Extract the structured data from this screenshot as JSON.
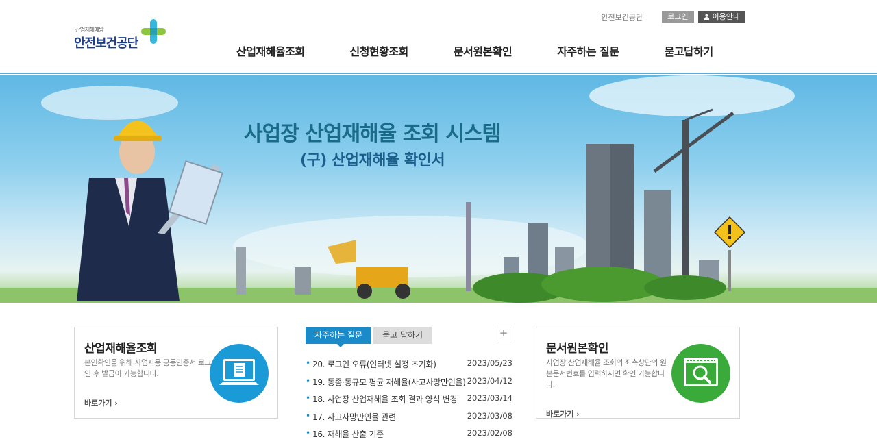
{
  "header": {
    "logo_small": "산업재해예방",
    "logo_main": "안전보건공단",
    "top_link": "안전보건공단",
    "login_label": "로그인",
    "guide_label": "이용안내",
    "nav": [
      "산업재해율조회",
      "신청현황조회",
      "문서원본확인",
      "자주하는 질문",
      "묻고답하기"
    ]
  },
  "hero": {
    "title": "사업장 산업재해율 조회 시스템",
    "subtitle": "(구) 산업재해율 확인서"
  },
  "box_left": {
    "title": "산업재해율조회",
    "desc": "본인확인을 위해 사업자용 공동인증서 로그인 후 발급이 가능합니다.",
    "more": "바로가기 ›"
  },
  "faq": {
    "tab_active": "자주하는 질문",
    "tab_other": "묻고 답하기",
    "plus": "+",
    "items": [
      {
        "title": "20. 로그인 오류(인터넷 설정 초기화)",
        "date": "2023/05/23"
      },
      {
        "title": "19. 동종·동규모 평균 재해율(사고사망만인율)",
        "date": "2023/04/12"
      },
      {
        "title": "18. 사업장 산업재해율 조회 결과 양식 변경",
        "date": "2023/03/14"
      },
      {
        "title": "17. 사고사망만인율 관련",
        "date": "2023/03/08"
      },
      {
        "title": "16. 재해율 산출 기준",
        "date": "2023/02/08"
      }
    ]
  },
  "box_right": {
    "title": "문서원본확인",
    "desc": "사업장 산업재해율 조회의 좌측상단의 원본문서번호를 입력하시면 확인 가능합니다.",
    "more": "바로가기 ›"
  },
  "colors": {
    "accent": "#1b8ac8",
    "green": "#3aaa3a",
    "brand_navy": "#1e3e86"
  }
}
